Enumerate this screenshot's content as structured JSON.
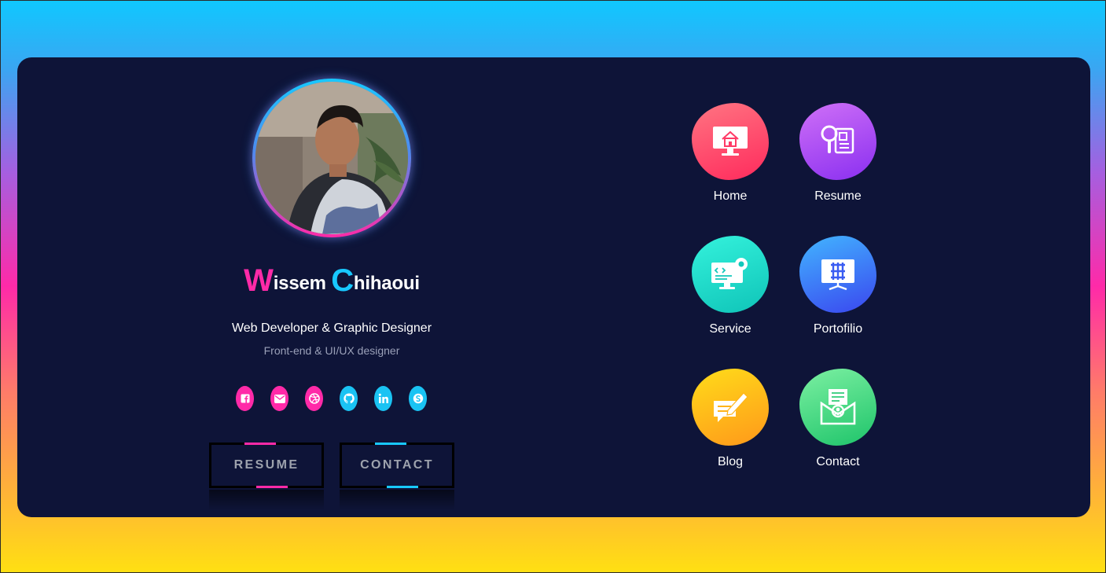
{
  "profile": {
    "name_first_initial": "W",
    "name_first_rest": "issem",
    "name_last_initial": "C",
    "name_last_rest": "hihaoui",
    "role": "Web Developer & Graphic Designer",
    "subtitle": "Front-end & UI/UX designer",
    "avatar_icon": "profile-photo"
  },
  "social": [
    {
      "icon": "facebook-icon",
      "color": "#ff2aa8"
    },
    {
      "icon": "mail-icon",
      "color": "#ff2aa8"
    },
    {
      "icon": "dribbble-icon",
      "color": "#ff2aa8"
    },
    {
      "icon": "github-icon",
      "color": "#1ac3f3"
    },
    {
      "icon": "linkedin-icon",
      "color": "#1ac3f3"
    },
    {
      "icon": "skype-icon",
      "color": "#1ac3f3"
    }
  ],
  "buttons": {
    "resume_label": "RESUME",
    "contact_label": "CONTACT"
  },
  "nav": [
    {
      "label": "Home",
      "icon": "home-monitor-icon",
      "gradient": [
        "#ff6a7a",
        "#ff2a5c"
      ]
    },
    {
      "label": "Resume",
      "icon": "resume-search-icon",
      "gradient": [
        "#c86cf5",
        "#8a2ff0"
      ]
    },
    {
      "label": "Service",
      "icon": "code-settings-icon",
      "gradient": [
        "#2ef0d8",
        "#0fc4b8"
      ]
    },
    {
      "label": "Portofilio",
      "icon": "portfolio-grid-icon",
      "gradient": [
        "#3fb0ff",
        "#3a4cf0"
      ]
    },
    {
      "label": "Blog",
      "icon": "blog-edit-icon",
      "gradient": [
        "#ffd21a",
        "#ff9a1a"
      ]
    },
    {
      "label": "Contact",
      "icon": "contact-envelope-icon",
      "gradient": [
        "#7af0a0",
        "#1ec46a"
      ]
    }
  ],
  "colors": {
    "card_bg": "#0e1438",
    "accent_pink": "#ff2aa8",
    "accent_blue": "#18c8ff"
  }
}
